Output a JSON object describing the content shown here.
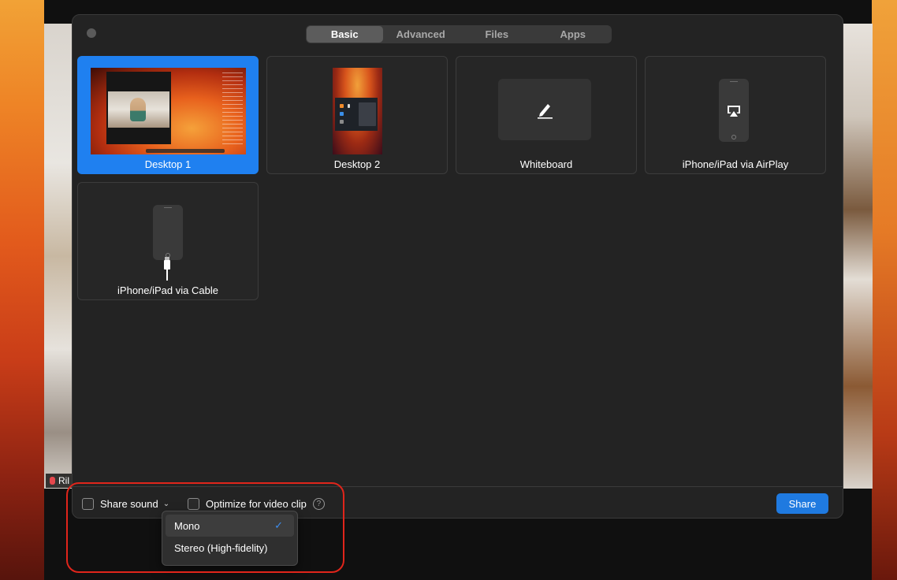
{
  "background": {
    "participant_name": "Ril"
  },
  "tabs": [
    {
      "label": "Basic",
      "active": true
    },
    {
      "label": "Advanced",
      "active": false
    },
    {
      "label": "Files",
      "active": false
    },
    {
      "label": "Apps",
      "active": false
    }
  ],
  "sources": [
    {
      "label": "Desktop 1",
      "selected": true,
      "icon": "desktop-thumbnail"
    },
    {
      "label": "Desktop 2",
      "selected": false,
      "icon": "desktop-thumbnail"
    },
    {
      "label": "Whiteboard",
      "selected": false,
      "icon": "pencil-icon"
    },
    {
      "label": "iPhone/iPad via AirPlay",
      "selected": false,
      "icon": "airplay-icon"
    },
    {
      "label": "iPhone/iPad via Cable",
      "selected": false,
      "icon": "cable-icon"
    }
  ],
  "options": {
    "share_sound_label": "Share sound",
    "share_sound_checked": false,
    "optimize_label": "Optimize for video clip",
    "optimize_checked": false,
    "help_glyph": "?"
  },
  "share_button": "Share",
  "sound_menu": {
    "items": [
      {
        "label": "Mono",
        "checked": true
      },
      {
        "label": "Stereo (High-fidelity)",
        "checked": false
      }
    ],
    "check_glyph": "✓"
  },
  "colors": {
    "accent": "#1f80f0",
    "annotation": "#e0251b"
  }
}
